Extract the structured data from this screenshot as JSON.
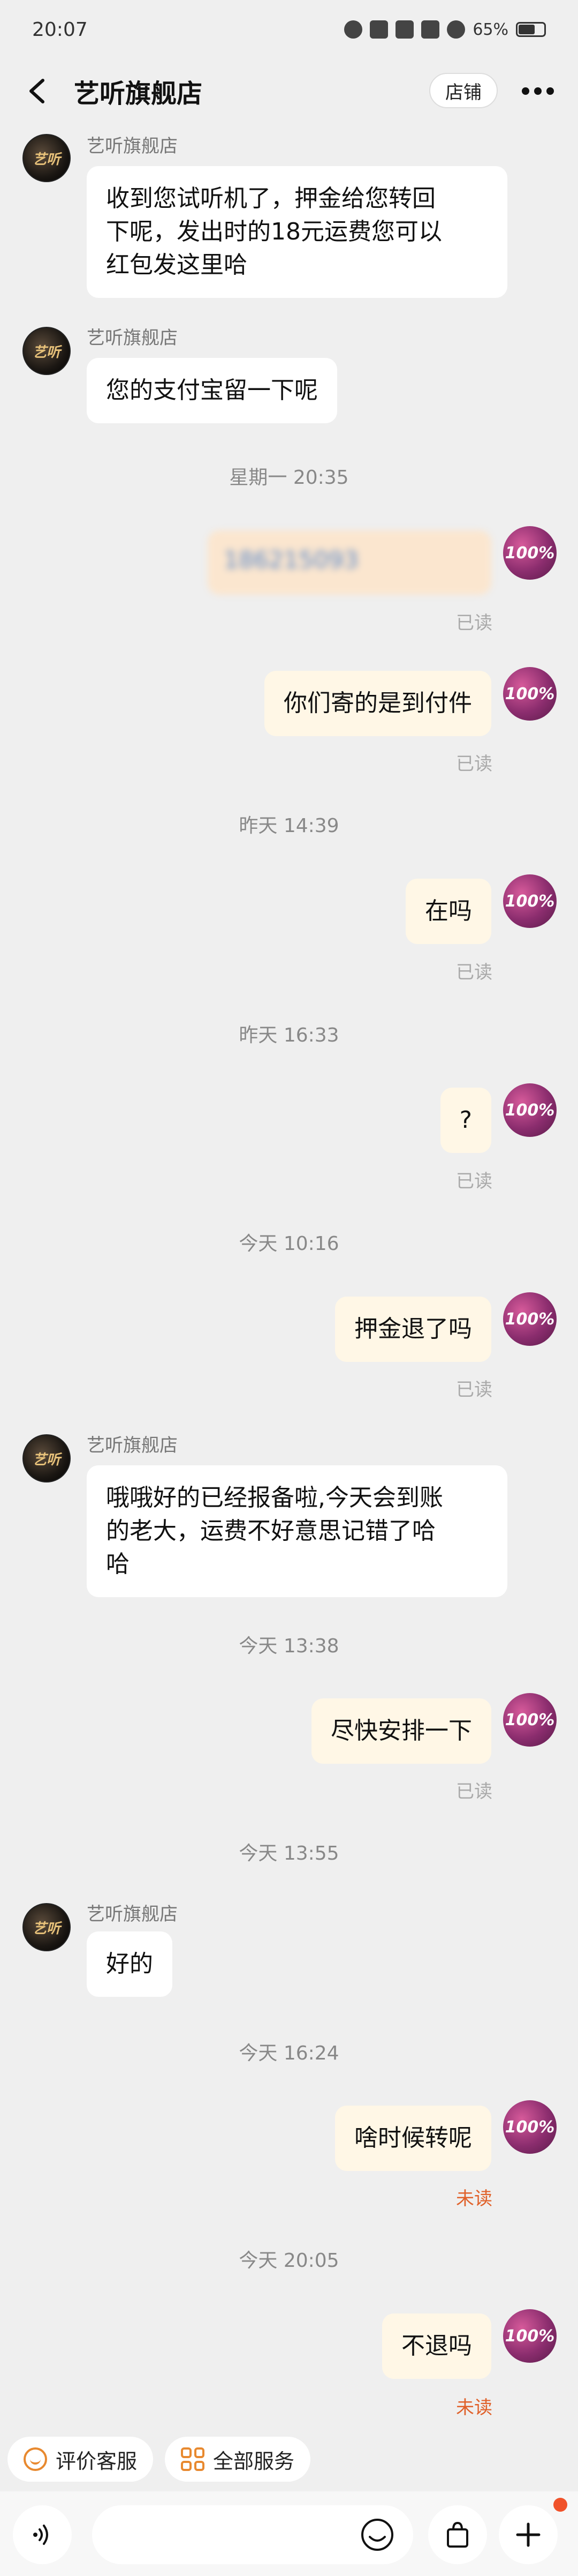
{
  "status_bar": {
    "time": "20:07",
    "battery": "65%",
    "battery_level": 0.65
  },
  "header": {
    "title": "艺听旗舰店",
    "shop_label": "店铺"
  },
  "shop_name": "艺听旗舰店",
  "avatar_text": "艺听",
  "my_avatar_text": "100%",
  "messages": [
    {
      "type": "in",
      "sender": "艺听旗舰店",
      "lines": [
        "收到您试听机了，押金给您转回",
        "下呢，发出时的18元运费您可以",
        "红包发这里哈"
      ]
    },
    {
      "type": "in",
      "sender": "艺听旗舰店",
      "text": "您的支付宝留一下呢"
    },
    {
      "type": "time",
      "text": "星期一 20:35"
    },
    {
      "type": "out",
      "text": "186215093",
      "status": "已读"
    },
    {
      "type": "out",
      "text": "你们寄的是到付件",
      "status": "已读"
    },
    {
      "type": "time",
      "text": "昨天 14:39"
    },
    {
      "type": "out",
      "text": "在吗",
      "status": "已读"
    },
    {
      "type": "time",
      "text": "昨天 16:33"
    },
    {
      "type": "out",
      "text": "?",
      "status": "已读"
    },
    {
      "type": "time",
      "text": "今天 10:16"
    },
    {
      "type": "out",
      "text": "押金退了吗",
      "status": "已读"
    },
    {
      "type": "in",
      "sender": "艺听旗舰店",
      "lines": [
        "哦哦好的已经报备啦,今天会到账",
        "的老大，运费不好意思记错了哈",
        "哈"
      ]
    },
    {
      "type": "time",
      "text": "今天 13:38"
    },
    {
      "type": "out",
      "text": "尽快安排一下",
      "status": "已读"
    },
    {
      "type": "time",
      "text": "今天 13:55"
    },
    {
      "type": "in",
      "sender": "艺听旗舰店",
      "text": "好的"
    },
    {
      "type": "time",
      "text": "今天 16:24"
    },
    {
      "type": "out",
      "text": "啥时候转呢",
      "status": "未读"
    },
    {
      "type": "time",
      "text": "今天 20:05"
    },
    {
      "type": "out",
      "text": "不退吗",
      "status": "未读"
    }
  ],
  "quick_actions": [
    {
      "label": "评价客服",
      "icon": "smile-icon"
    },
    {
      "label": "全部服务",
      "icon": "grid-icon"
    }
  ],
  "input": {
    "placeholder": ""
  },
  "colors": {
    "accent": "#e8892f",
    "unread": "#e0612a",
    "bubble_out": "#fff7e6"
  }
}
